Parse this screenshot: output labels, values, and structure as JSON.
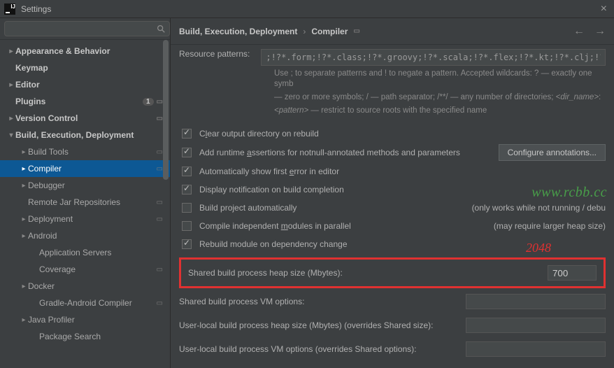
{
  "window": {
    "title": "Settings"
  },
  "search": {
    "placeholder": ""
  },
  "sidebar": {
    "items": [
      {
        "label": "Appearance & Behavior",
        "level": 1,
        "expand": "closed",
        "top": true
      },
      {
        "label": "Keymap",
        "level": 1,
        "expand": "none",
        "top": true
      },
      {
        "label": "Editor",
        "level": 1,
        "expand": "closed",
        "top": true
      },
      {
        "label": "Plugins",
        "level": 1,
        "expand": "none",
        "top": true,
        "badge": "1",
        "sep": true
      },
      {
        "label": "Version Control",
        "level": 1,
        "expand": "closed",
        "top": true,
        "sep": true
      },
      {
        "label": "Build, Execution, Deployment",
        "level": 1,
        "expand": "open",
        "top": true
      },
      {
        "label": "Build Tools",
        "level": 2,
        "expand": "closed",
        "sep": true
      },
      {
        "label": "Compiler",
        "level": 2,
        "expand": "closed",
        "sep": true,
        "selected": true
      },
      {
        "label": "Debugger",
        "level": 2,
        "expand": "closed"
      },
      {
        "label": "Remote Jar Repositories",
        "level": 2,
        "expand": "none",
        "sep": true
      },
      {
        "label": "Deployment",
        "level": 2,
        "expand": "closed",
        "sep": true
      },
      {
        "label": "Android",
        "level": 2,
        "expand": "closed"
      },
      {
        "label": "Application Servers",
        "level": 3,
        "expand": "none"
      },
      {
        "label": "Coverage",
        "level": 3,
        "expand": "none",
        "sep": true
      },
      {
        "label": "Docker",
        "level": 2,
        "expand": "closed"
      },
      {
        "label": "Gradle-Android Compiler",
        "level": 3,
        "expand": "none",
        "sep": true
      },
      {
        "label": "Java Profiler",
        "level": 2,
        "expand": "closed"
      },
      {
        "label": "Package Search",
        "level": 3,
        "expand": "none"
      }
    ]
  },
  "crumbs": {
    "a": "Build, Execution, Deployment",
    "b": "Compiler"
  },
  "resource": {
    "label": "Resource patterns:",
    "value": ";!?*.form;!?*.class;!?*.groovy;!?*.scala;!?*.flex;!?*.kt;!?*.clj;!?*.a",
    "hint1": "Use ; to separate patterns and ! to negate a pattern. Accepted wildcards: ? — exactly one symb",
    "hint2": "— zero or more symbols; / — path separator; /**/ — any number of directories; <dir_name>:",
    "hint3": "<pattern> — restrict to source roots with the specified name"
  },
  "opts": {
    "clear": {
      "label": "Clear output directory on rebuild",
      "checked": true
    },
    "asserts": {
      "label": "Add runtime assertions for notnull-annotated methods and parameters",
      "checked": true,
      "btn": "Configure annotations..."
    },
    "firsterr": {
      "label": "Automatically show first error in editor",
      "checked": true
    },
    "notify": {
      "label": "Display notification on build completion",
      "checked": true
    },
    "auto": {
      "label": "Build project automatically",
      "checked": false,
      "note": "(only works while not running / debu"
    },
    "parallel": {
      "label": "Compile independent modules in parallel",
      "checked": false,
      "note": "(may require larger heap size)"
    },
    "depchange": {
      "label": "Rebuild module on dependency change",
      "checked": true
    }
  },
  "fields": {
    "heap": {
      "label": "Shared build process heap size (Mbytes):",
      "value": "700"
    },
    "vm": {
      "label": "Shared build process VM options:",
      "value": ""
    },
    "uheap": {
      "label": "User-local build process heap size (Mbytes) (overrides Shared size):",
      "value": ""
    },
    "uvm": {
      "label": "User-local build process VM options (overrides Shared options):",
      "value": ""
    }
  },
  "annot": {
    "value": "2048"
  },
  "watermark": "www.rcbb.cc"
}
